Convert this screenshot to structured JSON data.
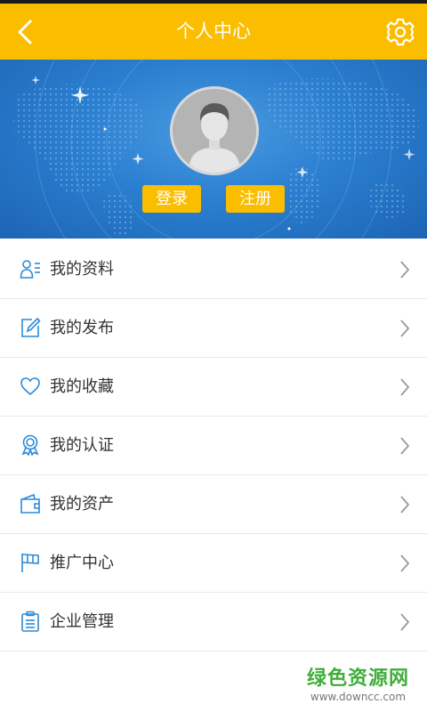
{
  "header": {
    "title": "个人中心",
    "icons": {
      "back": "back-arrow-icon",
      "settings": "gear-icon"
    },
    "color": "#fbbd00"
  },
  "profile": {
    "avatar_icon": "default-avatar-icon",
    "login_label": "登录",
    "register_label": "注册"
  },
  "menu": {
    "items": [
      {
        "label": "我的资料",
        "icon": "profile-icon"
      },
      {
        "label": "我的发布",
        "icon": "edit-icon"
      },
      {
        "label": "我的收藏",
        "icon": "heart-icon"
      },
      {
        "label": "我的认证",
        "icon": "badge-icon"
      },
      {
        "label": "我的资产",
        "icon": "wallet-icon"
      },
      {
        "label": "推广中心",
        "icon": "flag-icon"
      },
      {
        "label": "企业管理",
        "icon": "clipboard-icon"
      }
    ],
    "icon_color": "#2b8ad8"
  },
  "watermark": {
    "main": "绿色资源网",
    "sub": "www.downcc.com"
  }
}
